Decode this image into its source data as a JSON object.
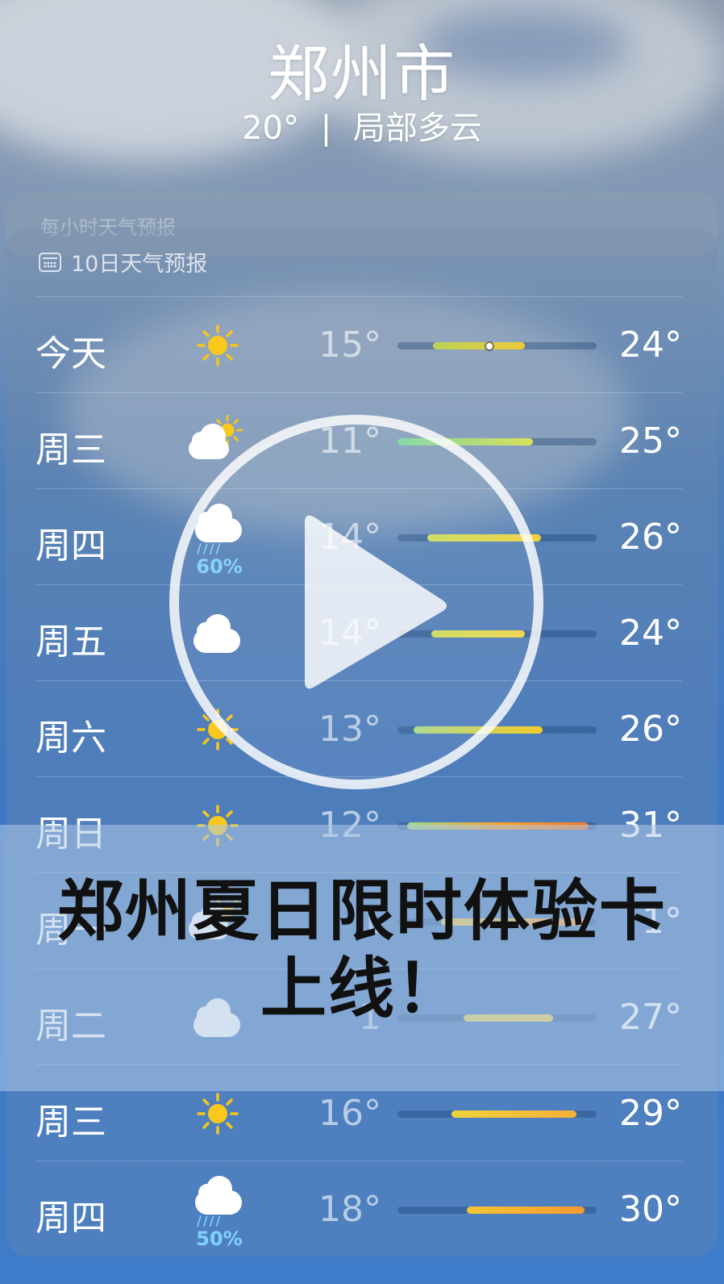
{
  "header": {
    "city": "郑州市",
    "current_temp": "20°",
    "separator": "|",
    "condition": "局部多云",
    "hourly_label": "每小时天气预报"
  },
  "forecast": {
    "title": "10日天气预报",
    "days": [
      {
        "day": "今天",
        "icon": "sun-icon",
        "precip": "",
        "low": "15°",
        "high": "24°",
        "range_start": 0.18,
        "range_end": 0.64,
        "current": 0.46,
        "colors": [
          "#b8d458",
          "#f0c83a"
        ]
      },
      {
        "day": "周三",
        "icon": "partly-cloudy-icon",
        "precip": "",
        "low": "11°",
        "high": "25°",
        "range_start": 0.0,
        "range_end": 0.68,
        "colors": [
          "#7ed6a4",
          "#d9e05a"
        ]
      },
      {
        "day": "周四",
        "icon": "rain-icon",
        "precip": "60%",
        "low": "14°",
        "high": "26°",
        "range_start": 0.15,
        "range_end": 0.72,
        "colors": [
          "#c9dc60",
          "#f2d140"
        ]
      },
      {
        "day": "周五",
        "icon": "cloud-icon",
        "precip": "",
        "low": "14°",
        "high": "24°",
        "range_start": 0.17,
        "range_end": 0.64,
        "colors": [
          "#c9dc60",
          "#f0d24a"
        ]
      },
      {
        "day": "周六",
        "icon": "sun-icon",
        "precip": "",
        "low": "13°",
        "high": "26°",
        "range_start": 0.08,
        "range_end": 0.73,
        "colors": [
          "#a8d88a",
          "#f2cb2a"
        ]
      },
      {
        "day": "周日",
        "icon": "sun-icon",
        "precip": "",
        "low": "12°",
        "high": "31°",
        "range_start": 0.05,
        "range_end": 0.96,
        "colors": [
          "#9edb88",
          "#f6a32e",
          "#f07a2a"
        ]
      },
      {
        "day": "周一",
        "icon": "partly-cloudy-icon",
        "precip": "",
        "low": "1",
        "high": "1°",
        "range_start": 0.22,
        "range_end": 0.95,
        "colors": [
          "#e9cf52",
          "#f39a3a"
        ]
      },
      {
        "day": "周二",
        "icon": "cloud-icon",
        "precip": "",
        "low": "1",
        "high": "27°",
        "range_start": 0.33,
        "range_end": 0.78,
        "colors": [
          "#e6d45e",
          "#f4cf5a"
        ]
      },
      {
        "day": "周三",
        "icon": "sun-icon",
        "precip": "",
        "low": "16°",
        "high": "29°",
        "range_start": 0.27,
        "range_end": 0.9,
        "colors": [
          "#f0d23a",
          "#f4b03a"
        ]
      },
      {
        "day": "周四",
        "icon": "rain-icon",
        "precip": "50%",
        "low": "18°",
        "high": "30°",
        "range_start": 0.35,
        "range_end": 0.94,
        "colors": [
          "#f3c436",
          "#f49a30"
        ]
      }
    ]
  },
  "promo": {
    "line1": "郑州夏日限时体验卡",
    "line2": "上线！"
  },
  "video": {
    "icon": "play-icon"
  }
}
